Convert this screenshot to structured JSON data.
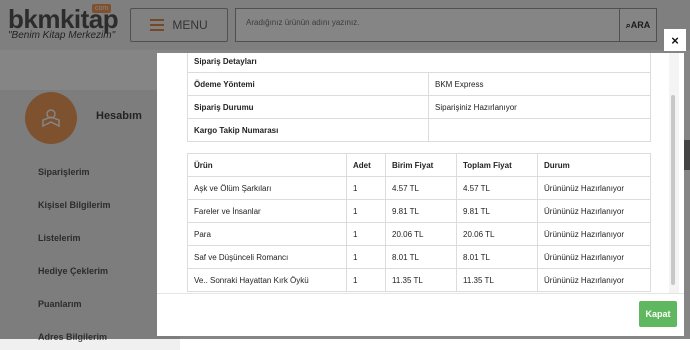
{
  "header": {
    "logo_text": "bkmkitap",
    "logo_badge": "com",
    "slogan": "\"Benim Kitap Merkezim\"",
    "menu_label": "MENU",
    "search_placeholder": "Aradığınız ürünün adını yazınız.",
    "search_button": "ARA"
  },
  "sidebar": {
    "title": "Hesabım",
    "items": [
      "Siparişlerim",
      "Kişisel Bilgilerim",
      "Listelerim",
      "Hediye Çeklerim",
      "Puanlarım",
      "Adres Bilgilerim"
    ]
  },
  "modal": {
    "close_symbol": "×",
    "details_title": "Sipariş Detayları",
    "details": [
      {
        "label": "Ödeme Yöntemi",
        "value": "BKM Express"
      },
      {
        "label": "Sipariş Durumu",
        "value": "Siparişiniz Hazırlanıyor"
      },
      {
        "label": "Kargo Takip Numarası",
        "value": ""
      }
    ],
    "columns": [
      "Ürün",
      "Adet",
      "Birim Fiyat",
      "Toplam Fiyat",
      "Durum"
    ],
    "rows": [
      [
        "Aşk ve Ölüm Şarkıları",
        "1",
        "4.57 TL",
        "4.57 TL",
        "Ürününüz Hazırlanıyor"
      ],
      [
        "Fareler ve İnsanlar",
        "1",
        "9.81 TL",
        "9.81 TL",
        "Ürününüz Hazırlanıyor"
      ],
      [
        "Para",
        "1",
        "20.06 TL",
        "20.06 TL",
        "Ürününüz Hazırlanıyor"
      ],
      [
        "Saf ve Düşünceli Romancı",
        "1",
        "8.01 TL",
        "8.01 TL",
        "Ürününüz Hazırlanıyor"
      ],
      [
        "Ve.. Sonraki Hayattan Kırk Öykü",
        "1",
        "11.35 TL",
        "11.35 TL",
        "Ürününüz Hazırlanıyor"
      ]
    ],
    "close_button": "Kapat"
  },
  "colors": {
    "accent_orange": "#f19c5b",
    "button_green": "#5fb85f"
  }
}
